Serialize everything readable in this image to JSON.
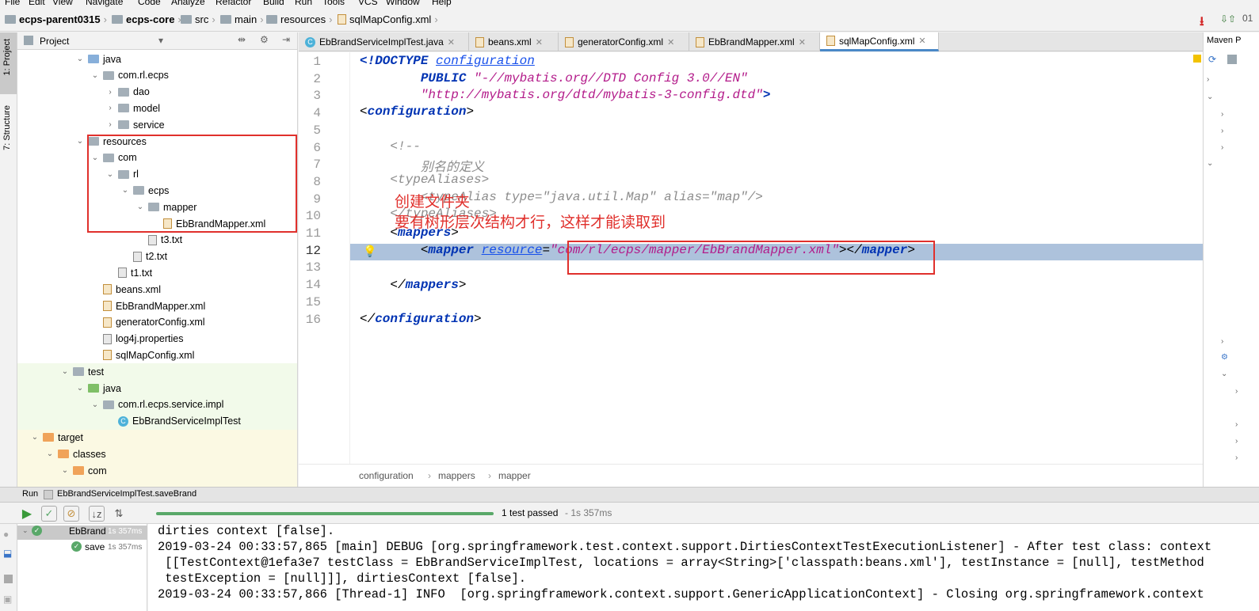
{
  "menu": [
    "File",
    "Edit",
    "View",
    "Navigate",
    "Code",
    "Analyze",
    "Refactor",
    "Build",
    "Run",
    "Tools",
    "VCS",
    "Window",
    "Help"
  ],
  "breadcrumb": [
    "ecps-parent0315",
    "ecps-core",
    "src",
    "main",
    "resources",
    "sqlMapConfig.xml"
  ],
  "left_strip": {
    "project": "1: Project",
    "structure": "7: Structure"
  },
  "project_panel": {
    "title": "Project",
    "tree": [
      {
        "label": "java",
        "level": 4,
        "icon": "folder-blue",
        "arrow": "v"
      },
      {
        "label": "com.rl.ecps",
        "level": 5,
        "icon": "folder-grey",
        "arrow": "v"
      },
      {
        "label": "dao",
        "level": 6,
        "icon": "folder-grey",
        "arrow": ">"
      },
      {
        "label": "model",
        "level": 6,
        "icon": "folder-grey",
        "arrow": ">"
      },
      {
        "label": "service",
        "level": 6,
        "icon": "folder-grey",
        "arrow": ">"
      },
      {
        "label": "resources",
        "level": 4,
        "icon": "folder-res",
        "arrow": "v"
      },
      {
        "label": "com",
        "level": 5,
        "icon": "folder-grey",
        "arrow": "v"
      },
      {
        "label": "rl",
        "level": 6,
        "icon": "folder-grey",
        "arrow": "v"
      },
      {
        "label": "ecps",
        "level": 7,
        "icon": "folder-grey",
        "arrow": "v"
      },
      {
        "label": "mapper",
        "level": 8,
        "icon": "folder-grey",
        "arrow": "v"
      },
      {
        "label": "EbBrandMapper.xml",
        "level": 9,
        "icon": "xml",
        "arrow": ""
      },
      {
        "label": "t3.txt",
        "level": 8,
        "icon": "txt",
        "arrow": ""
      },
      {
        "label": "t2.txt",
        "level": 7,
        "icon": "txt",
        "arrow": ""
      },
      {
        "label": "t1.txt",
        "level": 6,
        "icon": "txt",
        "arrow": ""
      },
      {
        "label": "beans.xml",
        "level": 5,
        "icon": "xml",
        "arrow": ""
      },
      {
        "label": "EbBrandMapper.xml",
        "level": 5,
        "icon": "xml",
        "arrow": ""
      },
      {
        "label": "generatorConfig.xml",
        "level": 5,
        "icon": "xml",
        "arrow": ""
      },
      {
        "label": "log4j.properties",
        "level": 5,
        "icon": "txt",
        "arrow": ""
      },
      {
        "label": "sqlMapConfig.xml",
        "level": 5,
        "icon": "xml",
        "arrow": ""
      },
      {
        "label": "test",
        "level": 3,
        "icon": "folder-grey",
        "arrow": "v"
      },
      {
        "label": "java",
        "level": 4,
        "icon": "folder-green",
        "arrow": "v"
      },
      {
        "label": "com.rl.ecps.service.impl",
        "level": 5,
        "icon": "folder-grey",
        "arrow": "v"
      },
      {
        "label": "EbBrandServiceImplTest",
        "level": 6,
        "icon": "class",
        "arrow": ""
      },
      {
        "label": "target",
        "level": 1,
        "icon": "folder-orange",
        "arrow": "v"
      },
      {
        "label": "classes",
        "level": 2,
        "icon": "folder-orange",
        "arrow": "v"
      },
      {
        "label": "com",
        "level": 3,
        "icon": "folder-orange",
        "arrow": "v"
      }
    ]
  },
  "tabs": [
    {
      "label": "EbBrandServiceImplTest.java",
      "active": false
    },
    {
      "label": "beans.xml",
      "active": false
    },
    {
      "label": "generatorConfig.xml",
      "active": false
    },
    {
      "label": "EbBrandMapper.xml",
      "active": false
    },
    {
      "label": "sqlMapConfig.xml",
      "active": true
    }
  ],
  "editor": {
    "lines": [
      "1",
      "2",
      "3",
      "4",
      "5",
      "6",
      "7",
      "8",
      "9",
      "10",
      "11",
      "12",
      "13",
      "14",
      "15",
      "16"
    ],
    "code": {
      "l1a": "<!DOCTYPE ",
      "l1b": "configuration",
      "l2a": "        PUBLIC ",
      "l2b": "\"-//mybatis.org//DTD Config 3.0//EN\"",
      "l3": "        \"http://mybatis.org/dtd/mybatis-3-config.dtd\"",
      "l3b": ">",
      "l4a": "<",
      "l4b": "configuration",
      "l4c": ">",
      "l6": "    <!--",
      "l7": "        别名的定义",
      "l8": "    <typeAliases>",
      "l9": "        <typeAlias type=\"java.util.Map\" alias=\"map\"/>",
      "l10": "    </typeAliases>",
      "l11a": "    <",
      "l11b": "mappers",
      "l11c": ">",
      "l12a": "        <",
      "l12b": "mapper",
      "l12c": " ",
      "l12d": "resource",
      "l12e": "=",
      "l12f": "\"com/rl/ecps/mapper/EbBrandMapper.xml\"",
      "l12g": "></",
      "l12h": "mapper",
      "l12i": ">",
      "l14a": "    </",
      "l14b": "mappers",
      "l14c": ">",
      "l16a": "</",
      "l16b": "configuration",
      "l16c": ">"
    },
    "crumbs": [
      "configuration",
      "mappers",
      "mapper"
    ]
  },
  "annotation": {
    "line1": "创建文件夹",
    "line2": "要有树形层次结构才行，这样才能读取到"
  },
  "right_panel": {
    "title": "Maven P"
  },
  "run": {
    "label": "Run",
    "config": "EbBrandServiceImplTest.saveBrand",
    "status": "1 test passed",
    "time": "- 1s 357ms",
    "tree": [
      {
        "label": "EbBrand",
        "time": "1s 357ms"
      },
      {
        "label": "save",
        "time": "1s 357ms"
      }
    ],
    "console": [
      "dirties context [false].",
      "2019-03-24 00:33:57,865 [main] DEBUG [org.springframework.test.context.support.DirtiesContextTestExecutionListener] - After test class: context",
      " [[TestContext@1efa3e7 testClass = EbBrandServiceImplTest, locations = array<String>['classpath:beans.xml'], testInstance = [null], testMethod",
      " testException = [null]]], dirtiesContext [false].",
      "2019-03-24 00:33:57,866 [Thread-1] INFO  [org.springframework.context.support.GenericApplicationContext] - Closing org.springframework.context"
    ]
  },
  "colors": {
    "accent": "#4a88c7",
    "annotation_red": "#e0302c",
    "highlight": "#adc2dc",
    "success": "#59a869"
  }
}
